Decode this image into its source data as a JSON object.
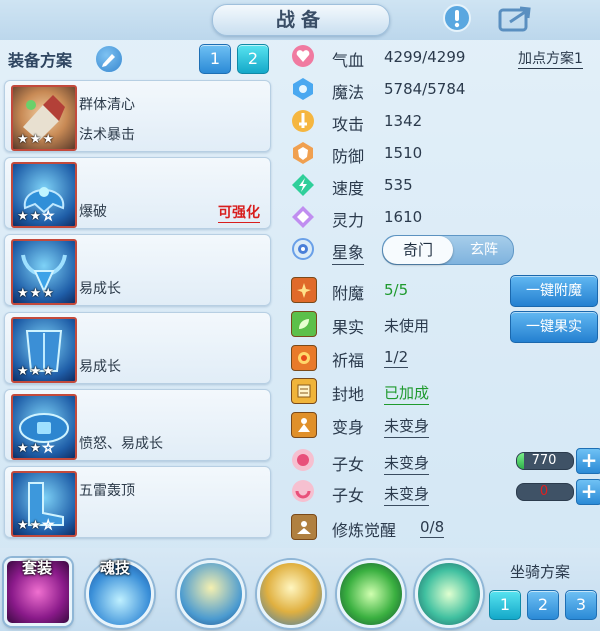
{
  "header": {
    "title": "战备"
  },
  "equip": {
    "label": "装备方案",
    "tabs": [
      "1",
      "2"
    ],
    "cards": [
      {
        "line1": "群体清心",
        "line2": "法术暴击",
        "stars": 3,
        "badge": ""
      },
      {
        "line1": "",
        "line2": "爆破",
        "stars": 2,
        "badge": "可强化"
      },
      {
        "line1": "",
        "line2": "易成长",
        "stars": 3,
        "badge": ""
      },
      {
        "line1": "",
        "line2": "易成长",
        "stars": 3,
        "badge": ""
      },
      {
        "line1": "",
        "line2": "愤怒、易成长",
        "stars": 2,
        "badge": ""
      },
      {
        "line1": "五雷轰顶",
        "line2": "",
        "stars": 2,
        "badge": ""
      }
    ]
  },
  "stats": {
    "plan_label": "加点方案1",
    "hp": {
      "label": "气血",
      "value": "4299/4299"
    },
    "mp": {
      "label": "魔法",
      "value": "5784/5784"
    },
    "atk": {
      "label": "攻击",
      "value": "1342"
    },
    "def": {
      "label": "防御",
      "value": "1510"
    },
    "spd": {
      "label": "速度",
      "value": "535"
    },
    "spirit": {
      "label": "灵力",
      "value": "1610"
    }
  },
  "xingxiang": {
    "label": "星象",
    "on": "奇门",
    "off": "玄阵"
  },
  "extra": {
    "fumo": {
      "label": "附魔",
      "value": "5/5",
      "button": "一键附魔"
    },
    "guoshi": {
      "label": "果实",
      "value": "未使用",
      "button": "一键果实"
    },
    "qifu": {
      "label": "祈福",
      "value": "1/2"
    },
    "fengdi": {
      "label": "封地",
      "value": "已加成"
    },
    "bianshen": {
      "label": "变身",
      "value": "未变身"
    },
    "zinv1": {
      "label": "子女",
      "value": "未变身",
      "bar_value": "770",
      "fill": 0.12
    },
    "zinv2": {
      "label": "子女",
      "value": "未变身",
      "bar_value": "0",
      "fill": 0
    },
    "xiulian": {
      "label": "修炼觉醒",
      "value": "0/8"
    }
  },
  "bottom": {
    "suit_label": "套装",
    "soul_label": "魂技",
    "mount_label": "坐骑方案",
    "mount_tabs": [
      "1",
      "2",
      "3"
    ]
  },
  "colors": {
    "accent": "#2b8ad6",
    "selected": "#14a8c9",
    "warn": "#d81e1e",
    "green": "#1f9a2e"
  }
}
